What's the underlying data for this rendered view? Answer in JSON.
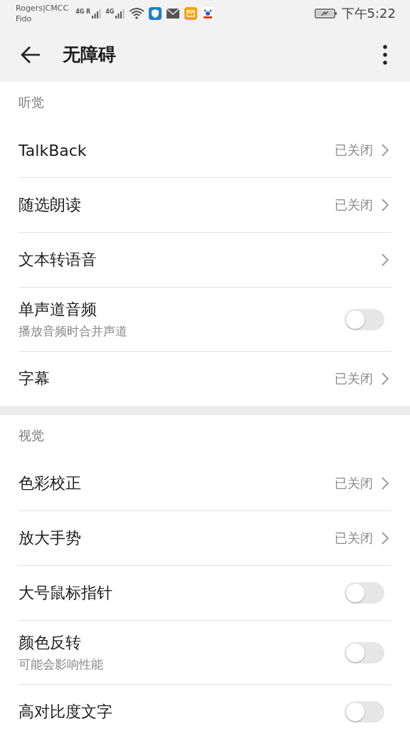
{
  "status_bar": {
    "carrier_1": "Rogers|CMCC",
    "carrier_2": "Fido",
    "signal_1": "4G R",
    "signal_2": "4G",
    "time": "下午5:22"
  },
  "app_bar": {
    "title": "无障碍"
  },
  "sections": [
    {
      "header": "听觉",
      "rows": [
        {
          "kind": "nav",
          "title": "TalkBack",
          "value": "已关闭"
        },
        {
          "kind": "nav",
          "title": "随选朗读",
          "value": "已关闭"
        },
        {
          "kind": "nav",
          "title": "文本转语音"
        },
        {
          "kind": "toggle",
          "title": "单声道音频",
          "subtitle": "播放音频时合并声道",
          "on": false
        },
        {
          "kind": "nav",
          "title": "字幕",
          "value": "已关闭"
        }
      ]
    },
    {
      "header": "视觉",
      "rows": [
        {
          "kind": "nav",
          "title": "色彩校正",
          "value": "已关闭"
        },
        {
          "kind": "nav",
          "title": "放大手势",
          "value": "已关闭"
        },
        {
          "kind": "toggle",
          "title": "大号鼠标指针",
          "on": false
        },
        {
          "kind": "toggle",
          "title": "颜色反转",
          "subtitle": "可能会影响性能",
          "on": false
        },
        {
          "kind": "toggle",
          "title": "高对比度文字",
          "on": false
        }
      ]
    }
  ]
}
